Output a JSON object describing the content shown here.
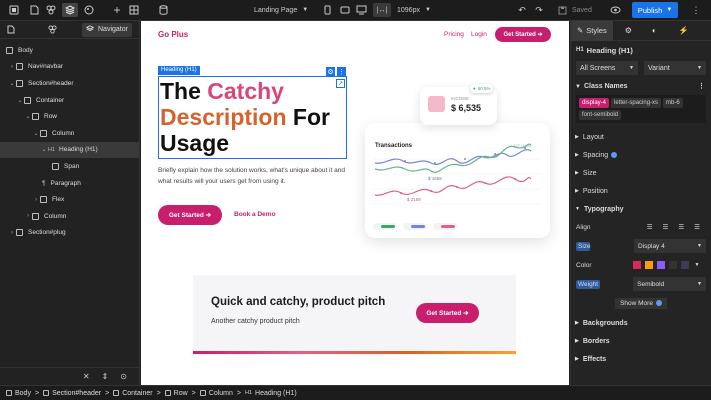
{
  "topbar": {
    "page_select": "Landing Page",
    "width_value": "1096px",
    "saved_label": "Saved",
    "publish_label": "Publish"
  },
  "left_panel": {
    "navigator_label": "Navigator",
    "tree": [
      {
        "label": "Body"
      },
      {
        "label": "Nav#navbar"
      },
      {
        "label": "Section#header"
      },
      {
        "label": "Container"
      },
      {
        "label": "Row"
      },
      {
        "label": "Column"
      },
      {
        "label": "Heading (H1)"
      },
      {
        "label": "Span"
      },
      {
        "label": "Paragraph"
      },
      {
        "label": "Flex"
      },
      {
        "label": "Column"
      },
      {
        "label": "Section#plug"
      }
    ]
  },
  "canvas": {
    "logo": "Go Plus",
    "nav_pricing": "Pricing",
    "nav_login": "Login",
    "nav_cta": "Get Started ➔",
    "selection_tag": "Heading (H1)",
    "heading_w1": "The",
    "heading_w2": "Catchy",
    "heading_w3": "Description",
    "heading_w4": "For",
    "heading_w5": "Usage",
    "paragraph": "Briefly explain how the solution works, what's unique about it and what results will your users get from using it.",
    "cta_primary": "Get Started ➔",
    "cta_secondary": "Book a Demo",
    "income_label": "INCOME",
    "income_value": "$ 6,535",
    "income_badge": "50.5%",
    "transactions_title": "Transactions",
    "transactions_legend": "• LAST  • NOW",
    "chart_label_1": "$ 1658",
    "chart_label_2": "$ 2158",
    "plug_title": "Quick and catchy, product pitch",
    "plug_sub": "Another catchy product pitch",
    "plug_cta": "Get Started ➔"
  },
  "right_panel": {
    "tab_styles": "Styles",
    "element_title": "Heading (H1)",
    "screens_select": "All Screens",
    "variant_select": "Variant",
    "class_names_label": "Class Names",
    "classes": [
      "display-4",
      "letter-spacing-xs",
      "mb-6",
      "font-semibold"
    ],
    "sections": [
      "Layout",
      "Spacing",
      "Size",
      "Position"
    ],
    "typography_label": "Typography",
    "align_label": "Align",
    "size_label": "Size",
    "size_value": "Display 4",
    "color_label": "Color",
    "weight_label": "Weight",
    "weight_value": "Semibold",
    "show_more": "Show More",
    "bottom_sections": [
      "Backgrounds",
      "Borders",
      "Effects"
    ],
    "colors": [
      "#e0245e",
      "#f59e0b",
      "#8b5cf6",
      "#333333",
      "#3b3b55"
    ]
  },
  "breadcrumb": [
    "Body",
    "Section#header",
    "Container",
    "Row",
    "Column",
    "Heading (H1)"
  ]
}
